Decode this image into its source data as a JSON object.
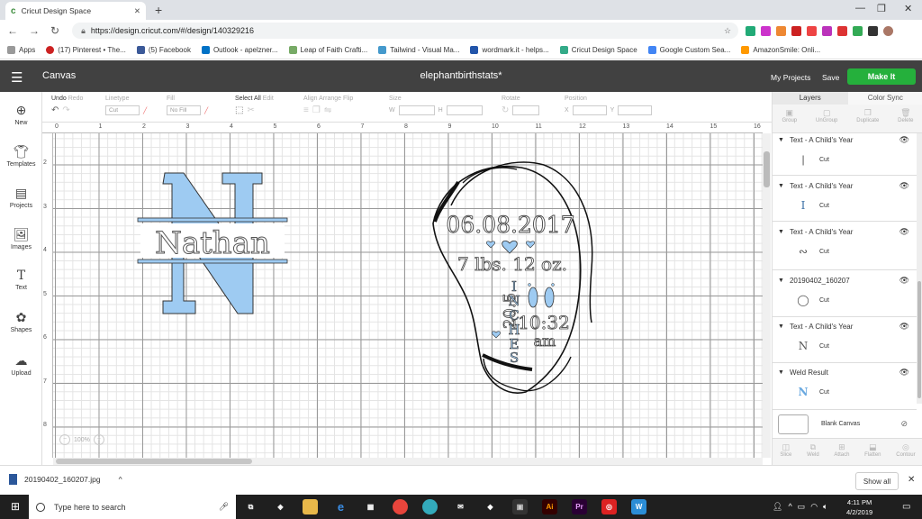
{
  "browser": {
    "tab_title": "Cricut Design Space",
    "url": "https://design.cricut.com/#/design/140329216",
    "bookmarks": [
      "Apps",
      "(17) Pinterest • The...",
      "(5) Facebook",
      "Outlook - apelzner...",
      "Leap of Faith Crafti...",
      "Tailwind - Visual Ma...",
      "wordmark.it - helps...",
      "Cricut Design Space",
      "Google Custom Sea...",
      "AmazonSmile: Onli..."
    ]
  },
  "app": {
    "canvas_label": "Canvas",
    "project_title": "elephantbirthstats*",
    "my_projects": "My Projects",
    "save": "Save",
    "make_it": "Make It"
  },
  "leftbar": [
    "New",
    "Templates",
    "Projects",
    "Images",
    "Text",
    "Shapes",
    "Upload"
  ],
  "toolbar": {
    "undo": "Undo",
    "redo": "Redo",
    "linetype": "Linetype",
    "linetype_value": "Cut",
    "fill": "Fill",
    "fill_value": "No Fill",
    "select_all": "Select All",
    "edit": "Edit",
    "align": "Align",
    "arrange": "Arrange",
    "flip": "Flip",
    "size": "Size",
    "w": "W",
    "h": "H",
    "rotate": "Rotate",
    "position": "Position",
    "x": "X",
    "y": "Y"
  },
  "ruler": {
    "h": [
      "0",
      "1",
      "2",
      "3",
      "4",
      "5",
      "6",
      "7",
      "8",
      "9",
      "10",
      "11",
      "12",
      "13",
      "14",
      "15",
      "16"
    ],
    "v": [
      "2",
      "3",
      "4",
      "5",
      "6",
      "7",
      "8"
    ]
  },
  "zoom": "100%",
  "canvas_text": {
    "monogram_letter": "N",
    "monogram_name": "Nathan",
    "date": "06.08.2017",
    "weight": "7 lbs. 12 oz.",
    "length": "20.5",
    "inches": [
      "I",
      "N",
      "C",
      "H",
      "E",
      "S"
    ],
    "time": "10:32",
    "ampm": "am"
  },
  "layers_panel": {
    "tabs": [
      "Layers",
      "Color Sync"
    ],
    "tools_top": [
      "Group",
      "UnGroup",
      "Duplicate",
      "Delete"
    ],
    "layers": [
      {
        "name": "Text - A Child's Year",
        "op": "Cut"
      },
      {
        "name": "Text - A Child's Year",
        "op": "Cut"
      },
      {
        "name": "Text - A Child's Year",
        "op": "Cut"
      },
      {
        "name": "20190402_160207",
        "op": "Cut"
      },
      {
        "name": "Text - A Child's Year",
        "op": "Cut"
      },
      {
        "name": "Weld Result",
        "op": "Cut"
      }
    ],
    "blank_canvas": "Blank Canvas",
    "tools_bottom": [
      "Slice",
      "Weld",
      "Attach",
      "Flatten",
      "Contour"
    ]
  },
  "download": {
    "file": "20190402_160207.jpg",
    "show_all": "Show all"
  },
  "taskbar": {
    "search": "Type here to search",
    "time": "4:11 PM",
    "date": "4/2/2019"
  }
}
